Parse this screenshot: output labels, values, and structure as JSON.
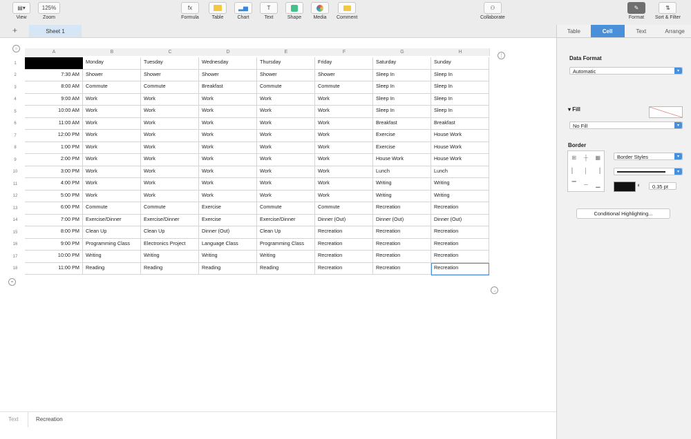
{
  "toolbar": {
    "view": "View",
    "zoom_value": "125%",
    "zoom": "Zoom",
    "formula_icon": "fx",
    "formula": "Formula",
    "table": "Table",
    "chart": "Chart",
    "text_icon": "T",
    "text": "Text",
    "shape": "Shape",
    "media": "Media",
    "comment": "Comment",
    "collaborate": "Collaborate",
    "format": "Format",
    "sort_filter": "Sort & Filter"
  },
  "sheet": {
    "add": "+",
    "tab": "Sheet 1"
  },
  "columns": [
    "A",
    "B",
    "C",
    "D",
    "E",
    "F",
    "G",
    "H"
  ],
  "rows": [
    [
      "",
      "Monday",
      "Tuesday",
      "Wednesday",
      "Thursday",
      "Friday",
      "Saturday",
      "Sunday"
    ],
    [
      "7:30 AM",
      "Shower",
      "Shower",
      "Shower",
      "Shower",
      "Shower",
      "Sleep In",
      "Sleep In"
    ],
    [
      "8:00 AM",
      "Commute",
      "Commute",
      "Breakfast",
      "Commute",
      "Commute",
      "Sleep In",
      "Sleep In"
    ],
    [
      "9:00 AM",
      "Work",
      "Work",
      "Work",
      "Work",
      "Work",
      "Sleep In",
      "Sleep In"
    ],
    [
      "10:00 AM",
      "Work",
      "Work",
      "Work",
      "Work",
      "Work",
      "Sleep In",
      "Sleep In"
    ],
    [
      "11:00 AM",
      "Work",
      "Work",
      "Work",
      "Work",
      "Work",
      "Breakfast",
      "Breakfast"
    ],
    [
      "12:00 PM",
      "Work",
      "Work",
      "Work",
      "Work",
      "Work",
      "Exercise",
      "House Work"
    ],
    [
      "1:00 PM",
      "Work",
      "Work",
      "Work",
      "Work",
      "Work",
      "Exercise",
      "House Work"
    ],
    [
      "2:00 PM",
      "Work",
      "Work",
      "Work",
      "Work",
      "Work",
      "House Work",
      "House Work"
    ],
    [
      "3:00 PM",
      "Work",
      "Work",
      "Work",
      "Work",
      "Work",
      "Lunch",
      "Lunch"
    ],
    [
      "4:00 PM",
      "Work",
      "Work",
      "Work",
      "Work",
      "Work",
      "Writing",
      "Writing"
    ],
    [
      "5:00 PM",
      "Work",
      "Work",
      "Work",
      "Work",
      "Work",
      "Writing",
      "Writing"
    ],
    [
      "6:00 PM",
      "Commute",
      "Commute",
      "Exercise",
      "Commute",
      "Commute",
      "Recreation",
      "Recreation"
    ],
    [
      "7:00 PM",
      "Exercise/Dinner",
      "Exercise/Dinner",
      "Exercise",
      "Exercise/Dinner",
      "Dinner (Out)",
      "Dinner (Out)",
      "Dinner (Out)"
    ],
    [
      "8:00 PM",
      "Clean Up",
      "Clean Up",
      "Dinner (Out)",
      "Clean Up",
      "Recreation",
      "Recreation",
      "Recreation"
    ],
    [
      "9:00 PM",
      "Programming Class",
      "Electronics Project",
      "Language Class",
      "Programming Class",
      "Recreation",
      "Recreation",
      "Recreation"
    ],
    [
      "10:00 PM",
      "Writing",
      "Writing",
      "Writing",
      "Writing",
      "Recreation",
      "Recreation",
      "Recreation"
    ],
    [
      "11:00 PM",
      "Reading",
      "Reading",
      "Reading",
      "Reading",
      "Recreation",
      "Recreation",
      "Recreation"
    ]
  ],
  "bottom": {
    "left": "Text",
    "value": "Recreation"
  },
  "inspector": {
    "tabs": [
      "Table",
      "Cell",
      "Text",
      "Arrange"
    ],
    "active_tab": "Cell",
    "data_format_label": "Data Format",
    "data_format_value": "Automatic",
    "fill_label": "Fill",
    "fill_value": "No Fill",
    "border_label": "Border",
    "border_styles": "Border Styles",
    "border_width": "0.35 pt",
    "conditional": "Conditional Highlighting..."
  },
  "colors": {
    "accent": "#4a8fd9",
    "selection_tab": "#d7e6f5"
  }
}
